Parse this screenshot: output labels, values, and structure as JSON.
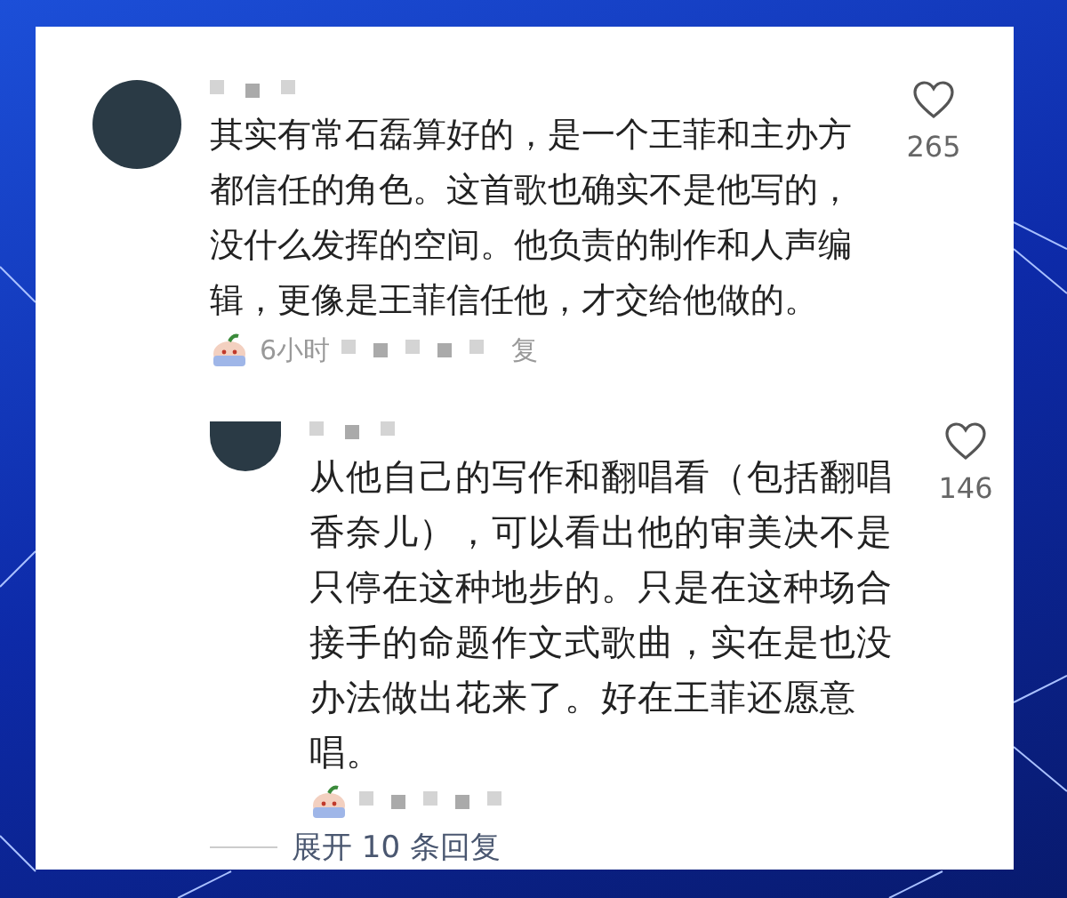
{
  "comments": [
    {
      "kind": "comment",
      "lines": [
        "其实有常石磊算好的，是一个王菲和主办方",
        "都信任的角色。这首歌也确实不是他写的，",
        "没什么发挥的空间。他负责的制作和人声编",
        "辑，更像是王菲信任他，才交给他做的。"
      ],
      "time": "6小时",
      "reply_tail": "复",
      "likes": "265"
    },
    {
      "kind": "reply",
      "lines": [
        "从他自己的写作和翻唱看（包括翻唱",
        "香奈儿），可以看出他的审美决不是",
        "只停在这种地步的。只是在这种场合",
        "接手的命题作文式歌曲，实在是也没",
        "办法做出花来了。好在王菲还愿意",
        "唱。"
      ],
      "likes": "146"
    }
  ],
  "expand": "展开 10 条回复"
}
